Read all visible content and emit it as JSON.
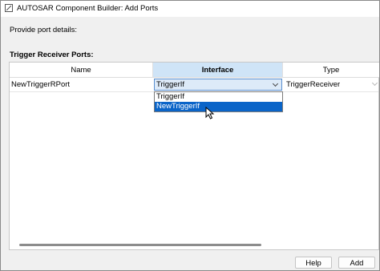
{
  "window": {
    "title": "AUTOSAR Component Builder: Add Ports"
  },
  "prompt": "Provide port details:",
  "section_title": "Trigger Receiver Ports:",
  "table": {
    "columns": [
      "Name",
      "Interface",
      "Type"
    ],
    "selected_column": "Interface",
    "rows": [
      {
        "name": "NewTriggerRPort",
        "interface": "TriggerIf",
        "type": "TriggerReceiver"
      }
    ]
  },
  "interface_dropdown": {
    "options": [
      "TriggerIf",
      "NewTriggerIf"
    ],
    "highlighted": "NewTriggerIf"
  },
  "buttons": {
    "help": "Help",
    "add": "Add"
  },
  "colors": {
    "selected_header": "#cfe4f7",
    "highlight": "#0a64c8",
    "combo_border": "#5a8fd0"
  }
}
